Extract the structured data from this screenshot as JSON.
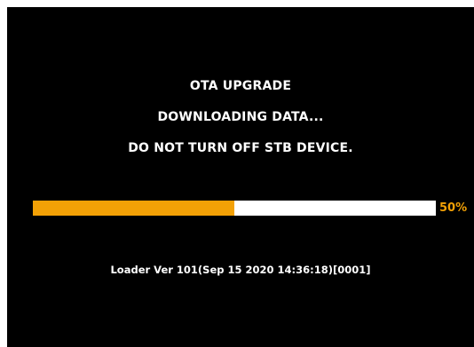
{
  "screen": {
    "title": "OTA UPGRADE",
    "status": "DOWNLOADING DATA...",
    "warning": "DO NOT TURN OFF STB DEVICE."
  },
  "progress": {
    "value": 0.5,
    "label": "50%",
    "fill_color": "#f3a106",
    "track_color": "#ffffff"
  },
  "footer": {
    "loader_version": "Loader Ver 101(Sep 15 2020 14:36:18)[0001]"
  }
}
